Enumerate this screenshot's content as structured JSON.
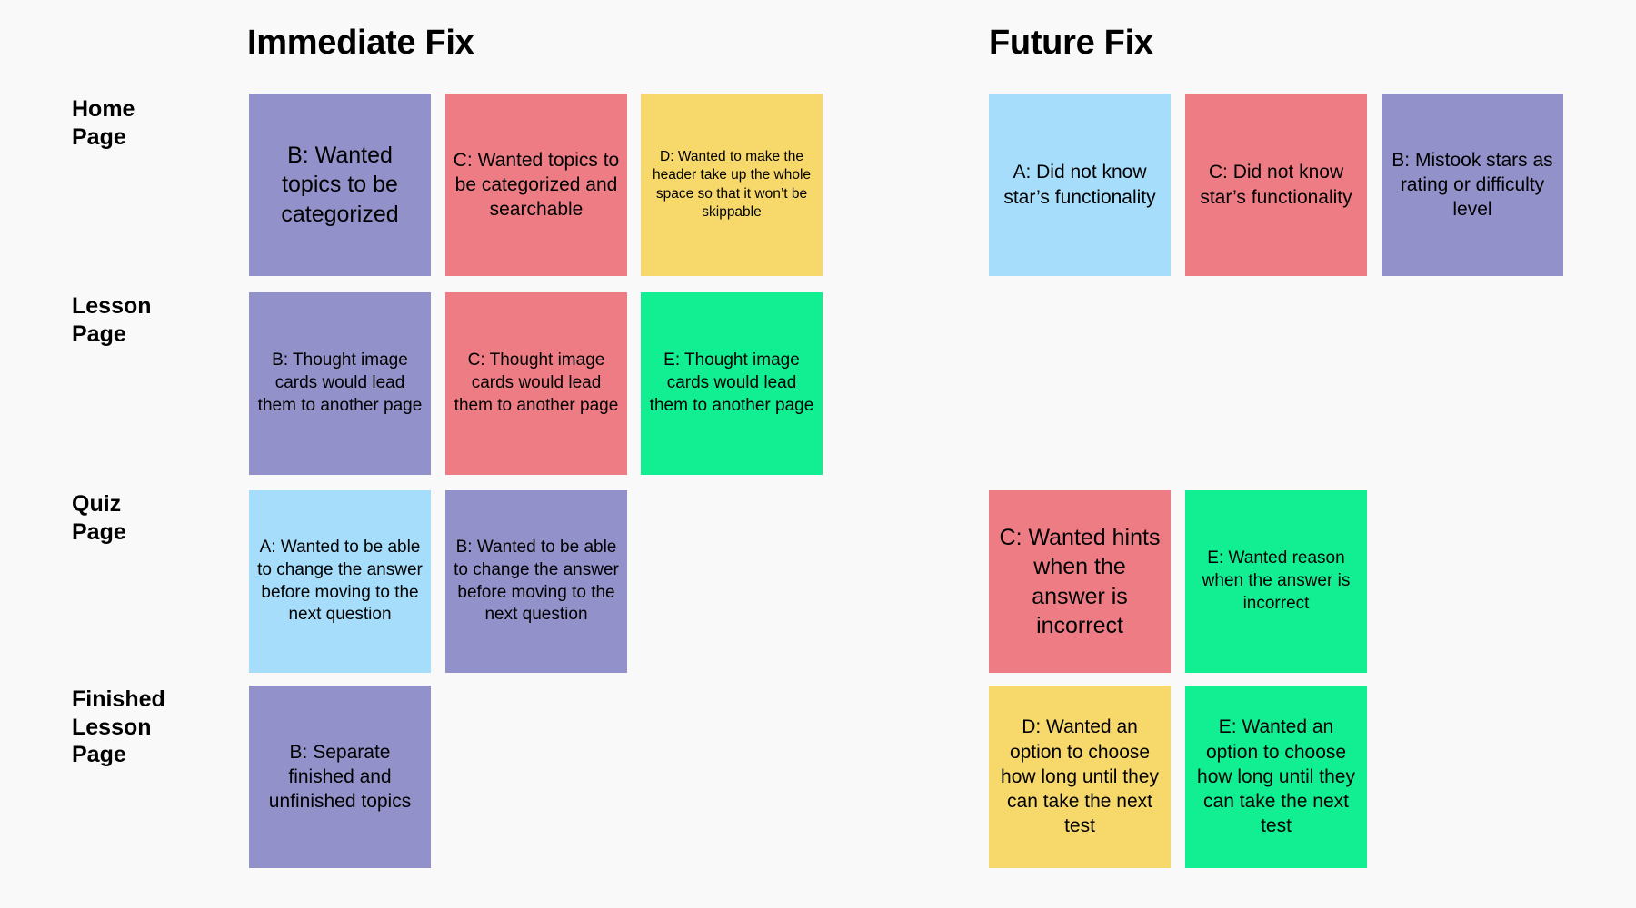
{
  "columns": [
    {
      "id": "immediate",
      "title": "Immediate Fix"
    },
    {
      "id": "future",
      "title": "Future Fix"
    }
  ],
  "rows": [
    {
      "id": "home-page",
      "label": "Home\nPage"
    },
    {
      "id": "lesson-page",
      "label": "Lesson\nPage"
    },
    {
      "id": "quiz-page",
      "label": "Quiz\nPage"
    },
    {
      "id": "finished-lesson-page",
      "label": "Finished\nLesson\nPage"
    }
  ],
  "colors": {
    "background": "#f9f9f9",
    "purple": "#9391c9",
    "red": "#ee7c85",
    "yellow": "#f7d96b",
    "blue": "#a5ddfa",
    "green": "#12ef92",
    "text": "#000000"
  },
  "notes": {
    "home_immediate_1": "B: Wanted topics to be categorized",
    "home_immediate_2": "C: Wanted topics to be categorized and searchable",
    "home_immediate_3": "D: Wanted to make the header take up the whole space so that it won’t be skippable",
    "home_future_1": "A: Did not know star’s functionality",
    "home_future_2": "C: Did not know star’s functionality",
    "home_future_3": "B: Mistook stars as rating or difficulty level",
    "lesson_immediate_1": "B: Thought image cards would lead them to another page",
    "lesson_immediate_2": "C: Thought image cards would lead them to another page",
    "lesson_immediate_3": "E: Thought image cards would lead them to another page",
    "quiz_immediate_1": "A: Wanted to be able to change the answer before moving to the next question",
    "quiz_immediate_2": "B: Wanted to be able to change the answer before moving to the next question",
    "quiz_future_1": "C: Wanted hints when the answer is incorrect",
    "quiz_future_2": "E: Wanted reason when the answer is incorrect",
    "finished_immediate_1": "B: Separate finished and unfinished topics",
    "finished_future_1": "D: Wanted an option to choose how long until they can take the next test",
    "finished_future_2": "E: Wanted an option to choose how long until they can take the next test"
  }
}
